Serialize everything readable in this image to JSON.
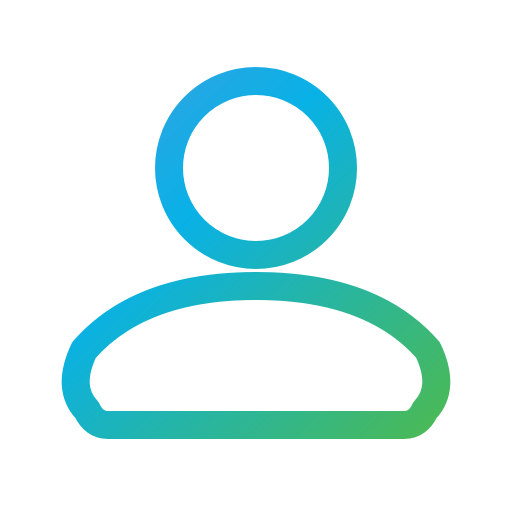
{
  "icon": {
    "name": "user-profile-icon",
    "style": "outline",
    "gradient": {
      "start_color": "#3f9fe0",
      "mid_color": "#08b1e6",
      "end_color": "#4cba52"
    },
    "background_color": "#ffffff"
  }
}
